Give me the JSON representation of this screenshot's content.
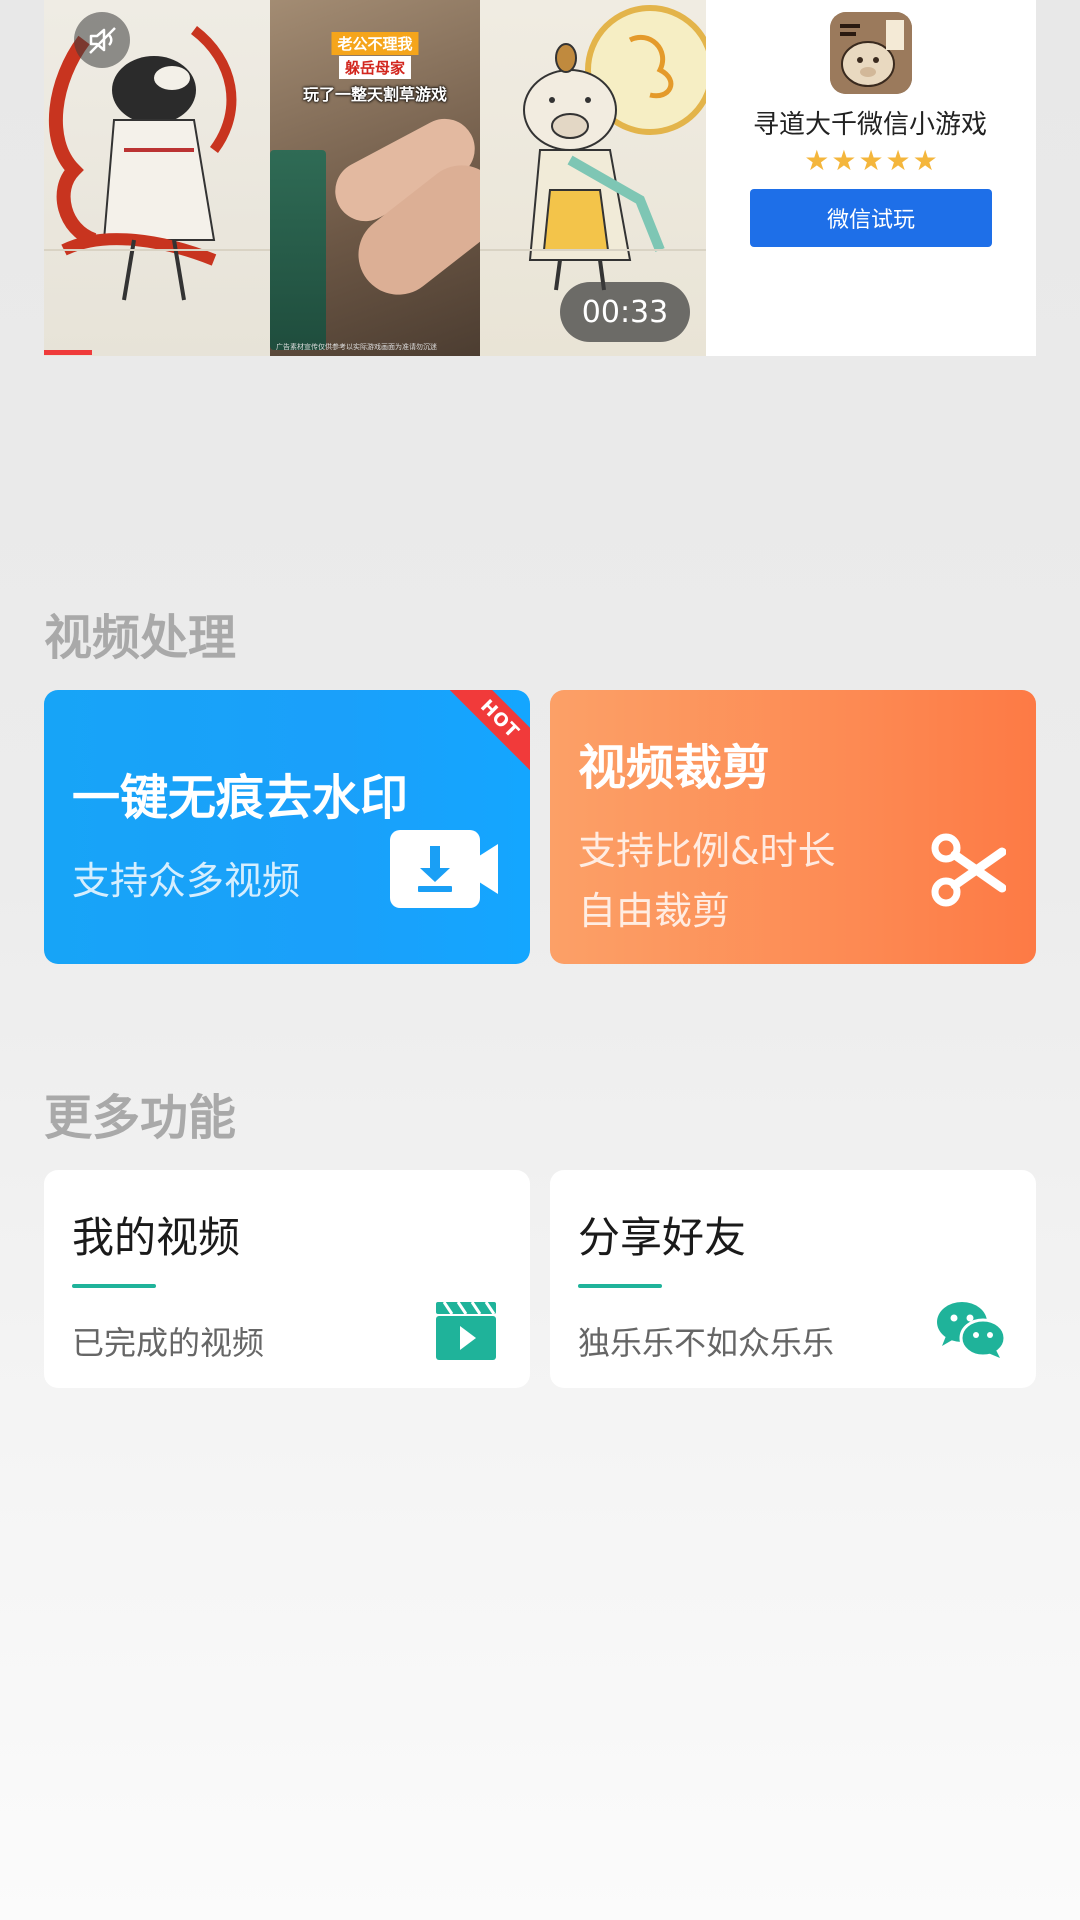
{
  "ad": {
    "video_captions": [
      "老公不理我",
      "躲岳母家",
      "玩了一整天割草游戏"
    ],
    "footer_text": "广告素材宣传仅供参考以实际游戏画面为准请勿沉迷",
    "duration": "00:33",
    "app_name": "寻道大千微信小游戏",
    "rating_stars": 5,
    "stars": [
      "★",
      "★",
      "★",
      "★",
      "★"
    ],
    "cta_label": "微信试玩",
    "icons": {
      "mute": "mute-icon",
      "app": "app-icon"
    }
  },
  "video_processing": {
    "title": "视频处理",
    "cards": [
      {
        "title": "一键无痕去水印",
        "subtitle": "支持众多视频",
        "badge": "HOT",
        "icon": "video-download-icon",
        "color": "#17a4f7"
      },
      {
        "title": "视频裁剪",
        "subtitle_lines": [
          "支持比例&时长",
          "自由裁剪"
        ],
        "icon": "scissors-icon",
        "color": "#fd8b54"
      }
    ]
  },
  "more": {
    "title": "更多功能",
    "cards": [
      {
        "title": "我的视频",
        "subtitle": "已完成的视频",
        "icon": "video-clapper-icon",
        "accent": "#1fb39a"
      },
      {
        "title": "分享好友",
        "subtitle": "独乐乐不如众乐乐",
        "icon": "wechat-icon",
        "accent": "#1fb39a"
      }
    ]
  }
}
